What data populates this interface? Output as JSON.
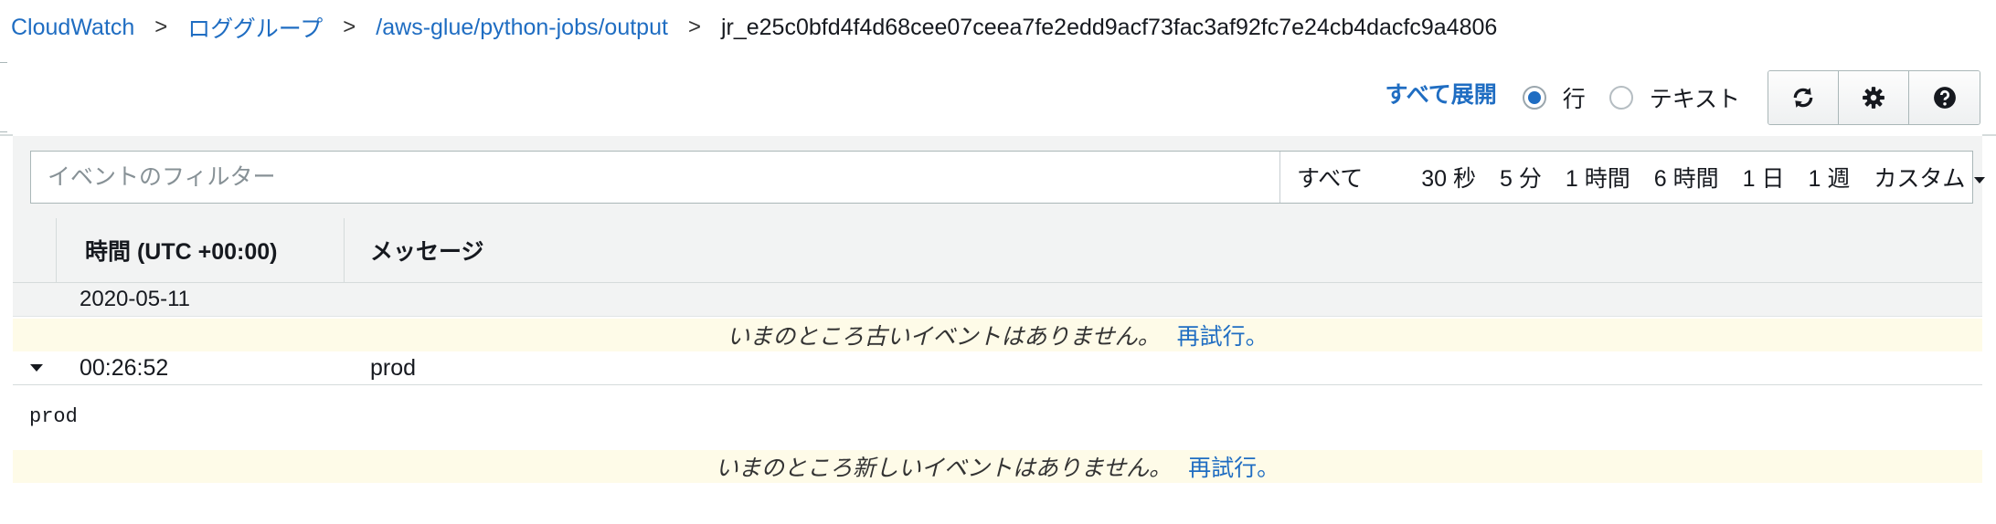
{
  "breadcrumb": {
    "items": [
      "CloudWatch",
      "ロググループ",
      "/aws-glue/python-jobs/output"
    ],
    "current": "jr_e25c0bfd4f4d68cee07ceea7fe2edd9acf73fac3af92fc7e24cb4dacfc9a4806",
    "separator": ">"
  },
  "toolbar": {
    "expand_all": "すべて展開",
    "view_mode": {
      "options": [
        "行",
        "テキスト"
      ],
      "selected": "行"
    },
    "buttons": [
      "refresh-icon",
      "gear-icon",
      "help-icon"
    ]
  },
  "filter": {
    "placeholder": "イベントのフィルター",
    "value": "",
    "time_ranges": {
      "all": "すべて",
      "options": [
        "30 秒",
        "5 分",
        "1 時間",
        "6 時間",
        "1 日",
        "1 週"
      ],
      "custom": "カスタム"
    }
  },
  "table": {
    "columns": [
      "時間 (UTC +00:00)",
      "メッセージ"
    ],
    "date_group": "2020-05-11",
    "older_notice": {
      "message": "いまのところ古いイベントはありません。",
      "retry": "再試行。"
    },
    "events": [
      {
        "time": "00:26:52",
        "message": "prod",
        "expanded": true,
        "detail": "prod"
      }
    ],
    "newer_notice": {
      "message": "いまのところ新しいイベントはありません。",
      "retry": "再試行。"
    }
  },
  "colors": {
    "link": "#1f6dc2",
    "notice_bg": "#fefbe8",
    "header_bg": "#f2f3f3"
  }
}
